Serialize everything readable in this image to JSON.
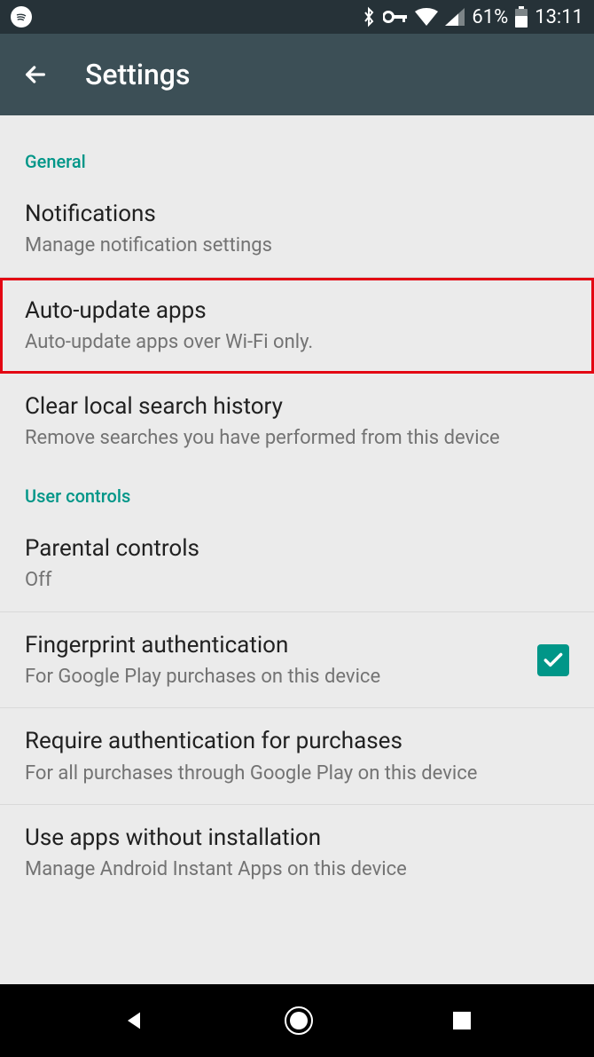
{
  "status": {
    "batteryPercent": "61%",
    "time": "13:11"
  },
  "header": {
    "title": "Settings"
  },
  "sections": {
    "general": {
      "label": "General",
      "notifications": {
        "title": "Notifications",
        "sub": "Manage notification settings"
      },
      "autoUpdate": {
        "title": "Auto-update apps",
        "sub": "Auto-update apps over Wi-Fi only."
      },
      "clearSearch": {
        "title": "Clear local search history",
        "sub": "Remove searches you have performed from this device"
      }
    },
    "user": {
      "label": "User controls",
      "parental": {
        "title": "Parental controls",
        "sub": "Off"
      },
      "fingerprint": {
        "title": "Fingerprint authentication",
        "sub": "For Google Play purchases on this device",
        "checked": true
      },
      "requireAuth": {
        "title": "Require authentication for purchases",
        "sub": "For all purchases through Google Play on this device"
      },
      "instantApps": {
        "title": "Use apps without installation",
        "sub": "Manage Android Instant Apps on this device"
      }
    }
  }
}
